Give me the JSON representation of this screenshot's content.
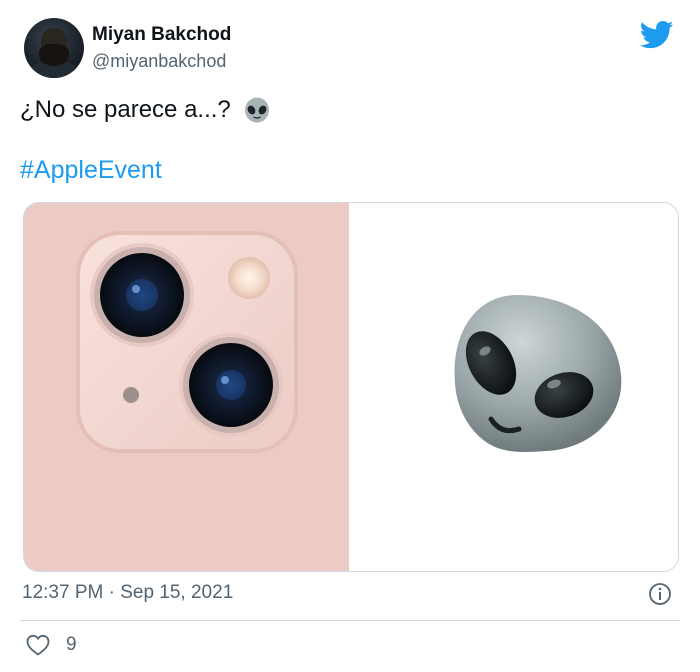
{
  "author": {
    "name": "Miyan Bakchod",
    "handle": "@miyanbakchod"
  },
  "tweet": {
    "text": "¿No se parece a...?",
    "emoji": "alien-emoji",
    "hashtag": "#AppleEvent"
  },
  "media": {
    "left_image": "iphone-13-pink-camera-module",
    "right_image": "alien-emoji-3d",
    "left_bg": "#eccbc6"
  },
  "meta": {
    "timestamp": "12:37 PM · Sep 15, 2021"
  },
  "engagement": {
    "likes": "9"
  },
  "colors": {
    "accent": "#1d9bf0",
    "text": "#0f1419",
    "secondary": "#536471",
    "border": "#cfd9de"
  },
  "icons": [
    "twitter-bird-icon",
    "info-icon",
    "heart-icon"
  ]
}
